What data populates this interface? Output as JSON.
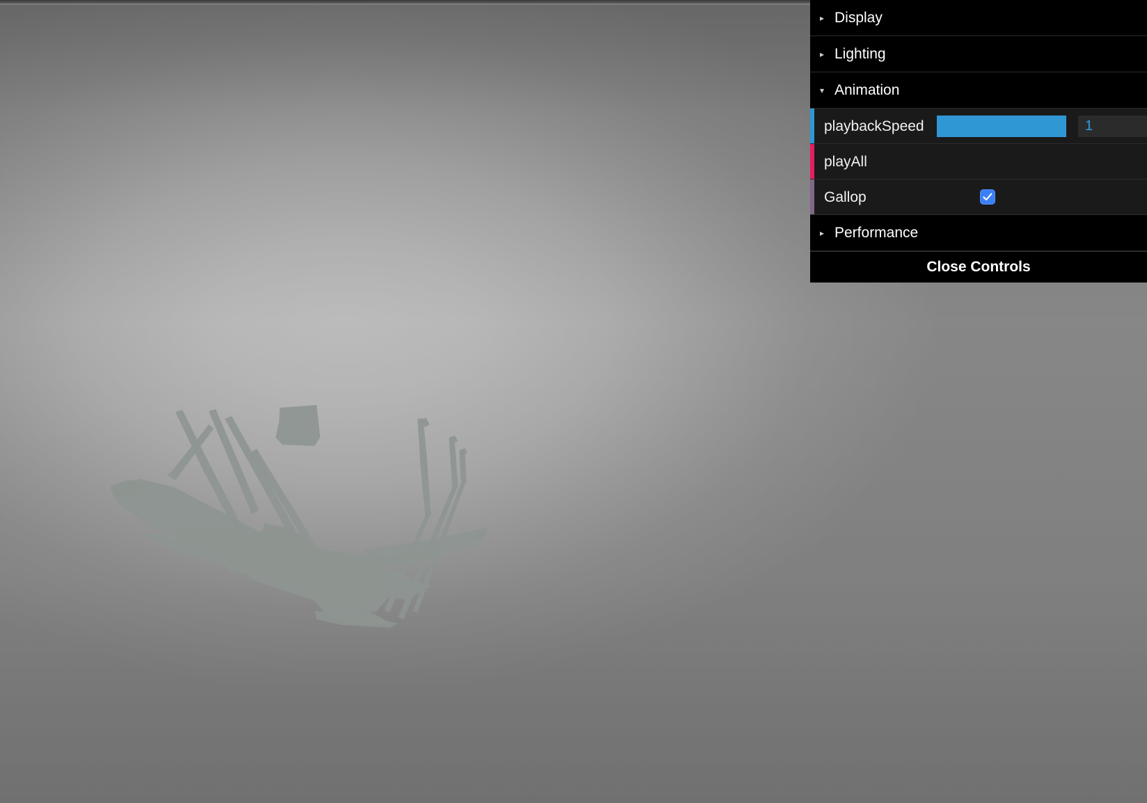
{
  "viewport": {
    "name": "3d-viewport",
    "background_top": "#8f8f8f",
    "background_center": "#fdfdfd",
    "model_color": "#8d9490",
    "model_description": "distorted animated horse mesh"
  },
  "gui": {
    "folders": [
      {
        "id": "display",
        "label": "Display",
        "caret": "▸",
        "open": false
      },
      {
        "id": "lighting",
        "label": "Lighting",
        "caret": "▸",
        "open": false
      },
      {
        "id": "animation",
        "label": "Animation",
        "caret": "▾",
        "open": true
      },
      {
        "id": "performance",
        "label": "Performance",
        "caret": "▸",
        "open": false
      }
    ],
    "animation_controllers": [
      {
        "id": "playbackSpeed",
        "label": "playbackSpeed",
        "type": "slider",
        "value": "1",
        "fill_percent": 100,
        "stripe_color": "#2f97d4",
        "fill_color": "#2f97d4",
        "value_color": "#2fa1dd"
      },
      {
        "id": "playAll",
        "label": "playAll",
        "type": "function",
        "stripe_color": "#e61d5f"
      },
      {
        "id": "Gallop",
        "label": "Gallop",
        "type": "checkbox",
        "checked": true,
        "stripe_color": "#806787",
        "checkbox_color": "#3b7ff5"
      }
    ],
    "close_label": "Close Controls"
  }
}
